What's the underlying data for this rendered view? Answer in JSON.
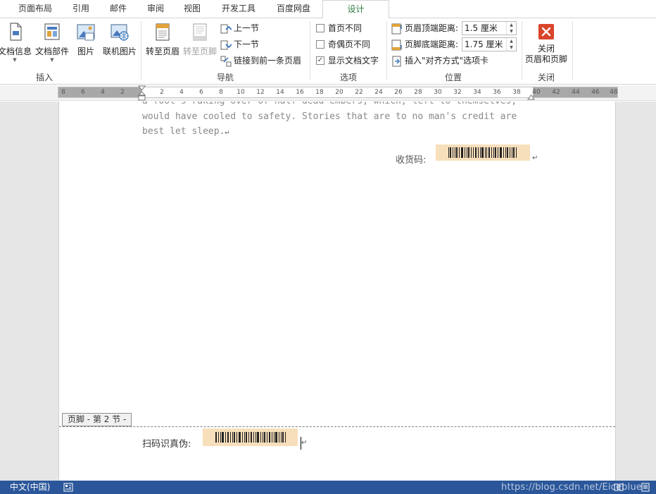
{
  "tabs": [
    {
      "label": "页面布局",
      "active": false
    },
    {
      "label": "引用",
      "active": false
    },
    {
      "label": "邮件",
      "active": false
    },
    {
      "label": "审阅",
      "active": false
    },
    {
      "label": "视图",
      "active": false
    },
    {
      "label": "开发工具",
      "active": false
    },
    {
      "label": "百度网盘",
      "active": false
    },
    {
      "label": "设计",
      "active": true
    }
  ],
  "ribbon": {
    "insert": {
      "doc_info": "文档信息",
      "doc_parts": "文档部件",
      "picture": "图片",
      "online_picture": "联机图片",
      "group_label": "插入"
    },
    "navigation": {
      "goto_header": "转至页眉",
      "goto_footer": "转至页脚",
      "prev_section": "上一节",
      "next_section": "下一节",
      "link_previous": "链接到前一条页眉",
      "group_label": "导航"
    },
    "options": {
      "first_page": "首页不同",
      "odd_even": "奇偶页不同",
      "show_text": "显示文档文字",
      "first_page_checked": false,
      "odd_even_checked": false,
      "show_text_checked": true,
      "group_label": "选项"
    },
    "position": {
      "header_from_top_label": "页眉顶端距离:",
      "header_from_top_value": "1.5 厘米",
      "footer_from_bottom_label": "页脚底端距离:",
      "footer_from_bottom_value": "1.75 厘米",
      "insert_align_tab": "插入\"对齐方式\"选项卡",
      "group_label": "位置"
    },
    "close": {
      "close_line1": "关闭",
      "close_line2": "页眉和页脚",
      "group_label": "关闭"
    }
  },
  "ruler": {
    "left_ticks": [
      "8",
      "6",
      "4",
      "2"
    ],
    "right_ticks": [
      "2",
      "4",
      "6",
      "8",
      "10",
      "12",
      "14",
      "16",
      "18",
      "20",
      "22",
      "24",
      "26",
      "28",
      "30",
      "32",
      "34",
      "36",
      "38",
      "40",
      "42",
      "44",
      "46",
      "48"
    ]
  },
  "document": {
    "line0": "a fool's raking over of half-dead embers, which, left to themselves,",
    "line1": "would have cooled to safety. Stories that are to no man's credit are",
    "line2": "best let sleep.",
    "receipt_label": "收货码:",
    "footer_tag": "页脚 - 第 2 节 -",
    "scan_label": "扫码识真伪:"
  },
  "status": {
    "language": "中文(中国)",
    "watermark": "https://blog.csdn.net/Eiceblue"
  },
  "colors": {
    "accent_tab": "#2b7a3d",
    "status_bar": "#2b579a",
    "barcode_bg": "#f7dfbb",
    "close_button": "#d9452b"
  }
}
